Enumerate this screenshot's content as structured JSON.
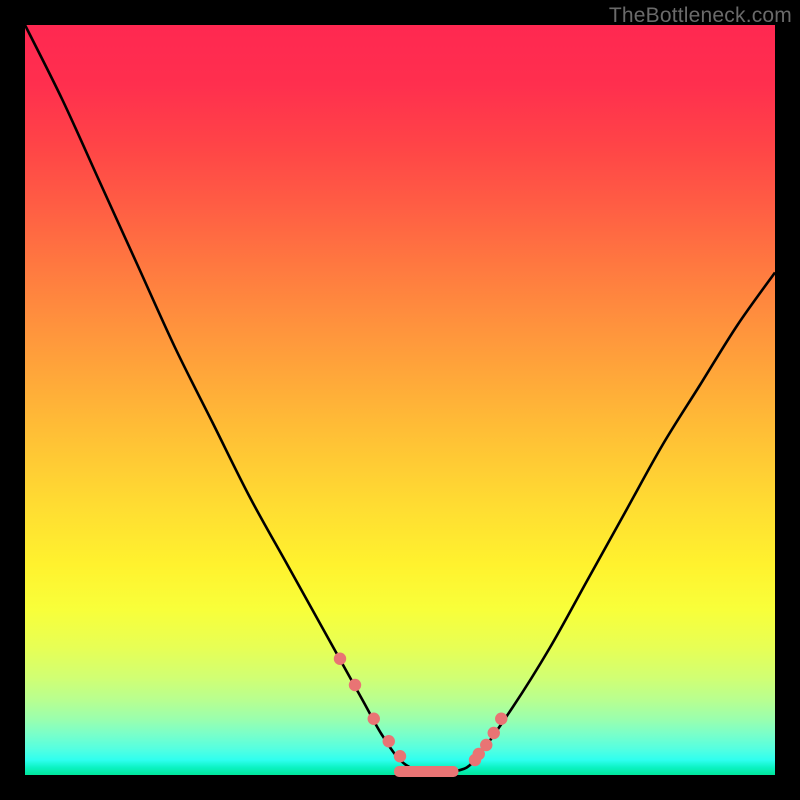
{
  "watermark": "TheBottleneck.com",
  "chart_data": {
    "type": "line",
    "title": "",
    "xlabel": "",
    "ylabel": "",
    "xlim": [
      0,
      1
    ],
    "ylim": [
      0,
      1
    ],
    "series": [
      {
        "name": "bottleneck-curve",
        "x": [
          0.0,
          0.05,
          0.1,
          0.15,
          0.2,
          0.25,
          0.3,
          0.35,
          0.4,
          0.45,
          0.475,
          0.5,
          0.525,
          0.55,
          0.575,
          0.6,
          0.65,
          0.7,
          0.75,
          0.8,
          0.85,
          0.9,
          0.95,
          1.0
        ],
        "values": [
          1.0,
          0.9,
          0.79,
          0.68,
          0.57,
          0.47,
          0.37,
          0.28,
          0.19,
          0.1,
          0.055,
          0.02,
          0.005,
          0.0,
          0.005,
          0.02,
          0.09,
          0.17,
          0.26,
          0.35,
          0.44,
          0.52,
          0.6,
          0.67
        ]
      },
      {
        "name": "marker-points",
        "x": [
          0.42,
          0.44,
          0.465,
          0.485,
          0.5,
          0.6,
          0.605,
          0.615,
          0.625,
          0.635
        ],
        "values": [
          0.155,
          0.12,
          0.075,
          0.045,
          0.025,
          0.02,
          0.028,
          0.04,
          0.056,
          0.075
        ]
      }
    ],
    "plateau": {
      "x0": 0.492,
      "x1": 0.578,
      "y": 0.004
    },
    "colors": {
      "curve": "#000000",
      "markers": "#e97474",
      "plateau": "#e97474"
    }
  }
}
